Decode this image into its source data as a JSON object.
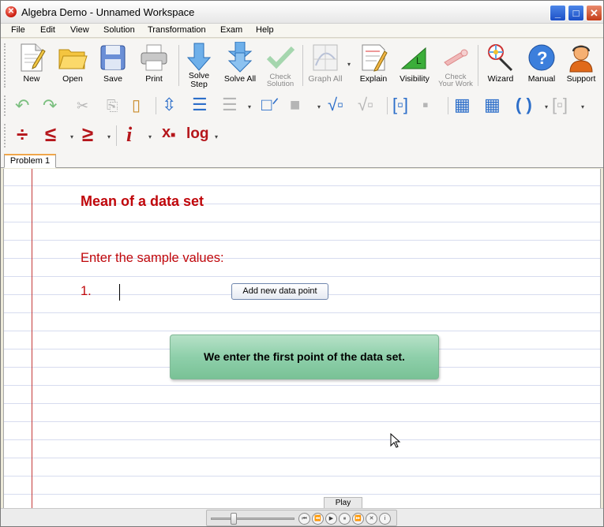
{
  "window": {
    "title": "Algebra Demo - Unnamed Workspace"
  },
  "menu": [
    "File",
    "Edit",
    "View",
    "Solution",
    "Transformation",
    "Exam",
    "Help"
  ],
  "toolbar": {
    "new": "New",
    "open": "Open",
    "save": "Save",
    "print": "Print",
    "solve_step_1": "Solve",
    "solve_step_2": "Step",
    "solve_all": "Solve All",
    "check_solution_1": "Check",
    "check_solution_2": "Solution",
    "graph_all": "Graph All",
    "explain": "Explain",
    "visibility": "Visibility",
    "check_work_1": "Check",
    "check_work_2": "Your Work",
    "wizard": "Wizard",
    "manual": "Manual",
    "support": "Support"
  },
  "math_toolbar": {
    "divide": "÷",
    "less_equal": "≤",
    "greater_equal": "≥",
    "imaginary": "i",
    "subscript": "x",
    "log": "log",
    "parens": "( )"
  },
  "tabs": [
    "Problem 1"
  ],
  "content": {
    "heading": "Mean of a data set",
    "prompt": "Enter the sample values:",
    "item_number": "1.",
    "add_button": "Add new data point",
    "callout": "We enter the first point of the data set."
  },
  "player": {
    "play_label": "Play",
    "progress": 0.27
  }
}
